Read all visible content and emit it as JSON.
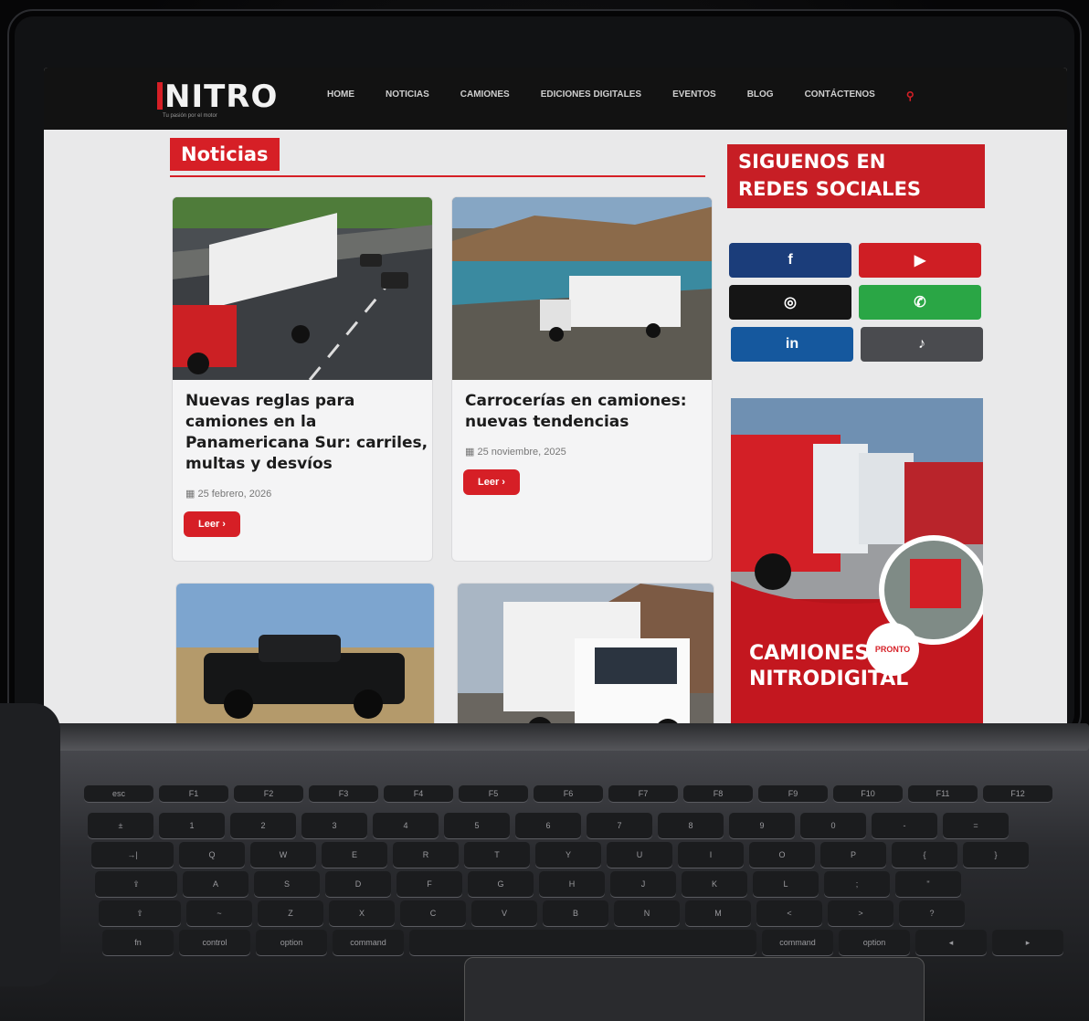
{
  "header": {
    "logo": "NITRO",
    "tagline": "Tu pasión por el motor",
    "nav": [
      "HOME",
      "NOTICIAS",
      "CAMIONES",
      "EDICIONES DIGITALES",
      "EVENTOS",
      "BLOG",
      "CONTÁCTENOS"
    ],
    "search_icon": "search-icon"
  },
  "section": {
    "title": "Noticias"
  },
  "articles": [
    {
      "title_lines": [
        "Nuevas reglas para",
        "camiones en la",
        "Panamericana Sur: carriles,",
        "multas y desvíos"
      ],
      "date": "25 febrero, 2026",
      "button": "Leer ›"
    },
    {
      "title_lines": [
        "Carrocerías en camiones:",
        "nuevas tendencias"
      ],
      "date": "25 noviembre, 2025",
      "button": "Leer ›"
    }
  ],
  "sidebar": {
    "social_title_lines": [
      "SIGUENOS EN",
      "REDES SOCIALES"
    ],
    "social": [
      {
        "name": "facebook",
        "glyph": "f",
        "color": "#1b3d7a"
      },
      {
        "name": "youtube",
        "glyph": "▶",
        "color": "#cf1e24"
      },
      {
        "name": "instagram",
        "glyph": "◎",
        "color": "#151515"
      },
      {
        "name": "whatsapp",
        "glyph": "✆",
        "color": "#2aa645"
      },
      {
        "name": "linkedin",
        "glyph": "in",
        "color": "#15589e"
      },
      {
        "name": "tiktok",
        "glyph": "♪",
        "color": "#4a4b4f"
      }
    ],
    "promo": {
      "title_lines": [
        "CAMIONES",
        "NITRODIGITAL"
      ],
      "badge": "PRONTO"
    }
  },
  "keyboard": {
    "row1": [
      "esc",
      "F1",
      "F2",
      "F3",
      "F4",
      "F5",
      "F6",
      "F7",
      "F8",
      "F9",
      "F10",
      "F11",
      "F12"
    ],
    "row2": [
      "±",
      "1",
      "2",
      "3",
      "4",
      "5",
      "6",
      "7",
      "8",
      "9",
      "0",
      "-",
      "="
    ],
    "row3": [
      "→|",
      "Q",
      "W",
      "E",
      "R",
      "T",
      "Y",
      "U",
      "I",
      "O",
      "P",
      "{",
      "}"
    ],
    "row4": [
      "⇪",
      "A",
      "S",
      "D",
      "F",
      "G",
      "H",
      "J",
      "K",
      "L",
      ";",
      "\""
    ],
    "row5": [
      "⇧",
      "~",
      "Z",
      "X",
      "C",
      "V",
      "B",
      "N",
      "M",
      "<",
      ">",
      "?"
    ],
    "row6": [
      "fn",
      "control",
      "option",
      "command",
      "",
      "command",
      "option",
      "◂",
      "▸"
    ]
  }
}
